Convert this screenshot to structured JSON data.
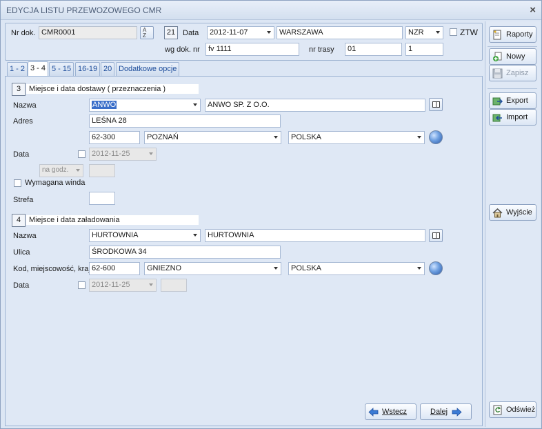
{
  "window": {
    "title": "EDYCJA LISTU PRZEWOZOWEGO CMR",
    "close_label": "×"
  },
  "header": {
    "nr_dok_label": "Nr dok.",
    "nr_dok_value": "CMR0001",
    "number_box": "21",
    "data_label": "Data",
    "data_value": "2012-11-07",
    "city_value": "WARSZAWA",
    "nzr_value": "NZR",
    "ztw_label": "ZTW",
    "wg_dok_label": "wg dok. nr",
    "wg_dok_value": "fv 1111",
    "nr_trasy_label": "nr trasy",
    "nr_trasy_value": "01",
    "trasy_second_value": "1"
  },
  "tabs": [
    {
      "label": "1 - 2"
    },
    {
      "label": "3 - 4"
    },
    {
      "label": "5 - 15"
    },
    {
      "label": "16-19"
    },
    {
      "label": "20"
    },
    {
      "label": "Dodatkowe opcje"
    }
  ],
  "delivery": {
    "number": "3",
    "title": "Miejsce i data dostawy ( przeznaczenia )",
    "nazwa_label": "Nazwa",
    "nazwa_code": "ANWO",
    "nazwa_full": "ANWO SP. Z O.O.",
    "adres_label": "Adres",
    "adres_value": "LEŚNA 28",
    "postal": "62-300",
    "city": "POZNAŃ",
    "country": "POLSKA",
    "data_label": "Data",
    "date_value": "2012-11-25",
    "time_mode": "na godz.",
    "winda_label": "Wymagana winda",
    "strefa_label": "Strefa"
  },
  "loading": {
    "number": "4",
    "title": "Miejsce i data załadowania",
    "nazwa_label": "Nazwa",
    "nazwa_code": "HURTOWNIA",
    "nazwa_full": "HURTOWNIA",
    "ulica_label": "Ulica",
    "ulica_value": "ŚRODKOWA 34",
    "kod_label": "Kod, miejscowość, kraj",
    "postal": "62-600",
    "city": "GNIEZNO",
    "country": "POLSKA",
    "data_label": "Data",
    "date_value": "2012-11-25"
  },
  "nav": {
    "back_label": "Wstecz",
    "next_label": "Dalej"
  },
  "sidebar": {
    "raporty": "Raporty",
    "nowy": "Nowy",
    "zapisz": "Zapisz",
    "export": "Export",
    "import": "Import",
    "wyjscie": "Wyjście",
    "odswiez": "Odśwież"
  },
  "colors": {
    "selection": "#3b6fc9",
    "accent_blue": "#1f4e9c",
    "arrow_blue": "#3a7bd5"
  }
}
